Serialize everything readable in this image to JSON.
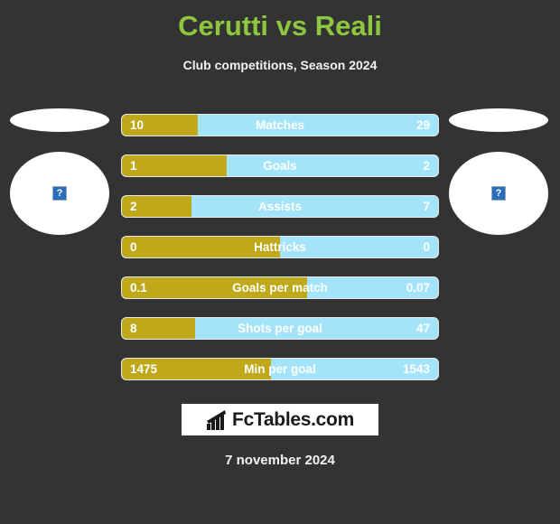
{
  "header": {
    "title": "Cerutti vs Reali",
    "subtitle": "Club competitions, Season 2024",
    "title_color": "#8DC63F"
  },
  "colors": {
    "background": "#333333",
    "home_bar": "#BFA81A",
    "away_bar": "#A3E4FA",
    "text": "#FFFFFF"
  },
  "players": {
    "home": {
      "photo_icon": "broken-image-icon",
      "photo_alt": "?"
    },
    "away": {
      "photo_icon": "broken-image-icon",
      "photo_alt": "?"
    }
  },
  "chart_data": {
    "type": "bar",
    "title": "Cerutti vs Reali",
    "subtitle": "Club competitions, Season 2024",
    "orientation": "horizontal-diverging",
    "categories": [
      "Matches",
      "Goals",
      "Assists",
      "Hattricks",
      "Goals per match",
      "Shots per goal",
      "Min per goal"
    ],
    "series": [
      {
        "name": "Cerutti",
        "color": "#BFA81A",
        "values": [
          10,
          1,
          2,
          0,
          0.1,
          8,
          1475
        ],
        "display": [
          "10",
          "1",
          "2",
          "0",
          "0.1",
          "8",
          "1475"
        ],
        "fill_percent": [
          24,
          33,
          22,
          50,
          58.5,
          23,
          47
        ]
      },
      {
        "name": "Reali",
        "color": "#A3E4FA",
        "values": [
          29,
          2,
          7,
          0,
          0.07,
          47,
          1543
        ],
        "display": [
          "29",
          "2",
          "7",
          "0",
          "0.07",
          "47",
          "1543"
        ],
        "fill_percent": [
          76,
          67,
          78,
          50,
          41.5,
          77,
          53
        ]
      }
    ],
    "legend": "none",
    "grid": false
  },
  "rows": [
    {
      "label": "Matches",
      "home": "10",
      "away": "29",
      "fill": 24
    },
    {
      "label": "Goals",
      "home": "1",
      "away": "2",
      "fill": 33
    },
    {
      "label": "Assists",
      "home": "2",
      "away": "7",
      "fill": 22
    },
    {
      "label": "Hattricks",
      "home": "0",
      "away": "0",
      "fill": 50
    },
    {
      "label": "Goals per match",
      "home": "0.1",
      "away": "0.07",
      "fill": 58.5
    },
    {
      "label": "Shots per goal",
      "home": "8",
      "away": "47",
      "fill": 23
    },
    {
      "label": "Min per goal",
      "home": "1475",
      "away": "1543",
      "fill": 47
    }
  ],
  "footer": {
    "logo_text": "FcTables.com",
    "logo_icon": "bar-chart-icon",
    "date": "7 november 2024"
  }
}
